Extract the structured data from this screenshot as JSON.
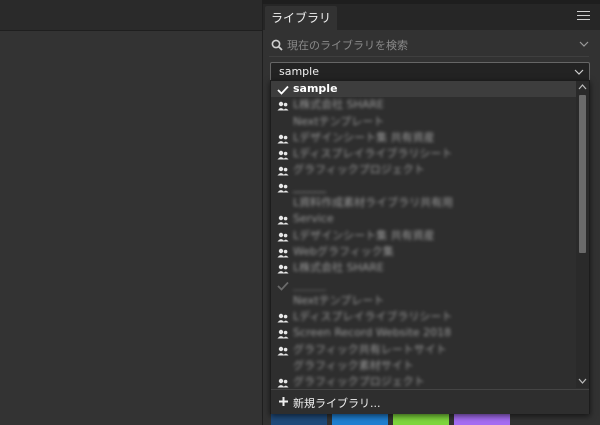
{
  "panel": {
    "tab_label": "ライブラリ",
    "menu_icon": "hamburger-menu-icon"
  },
  "search": {
    "placeholder": "現在のライブラリを検索",
    "icon": "search-icon"
  },
  "library_select": {
    "value": "sample"
  },
  "dropdown": {
    "items": [
      {
        "label": "sample",
        "icon": "checkmark-icon",
        "selected": true,
        "blurred": false
      },
      {
        "label": "L株式会社 SHARE",
        "icon": "shared-users-icon",
        "selected": false,
        "blurred": true
      },
      {
        "label": "Nextテンプレート",
        "icon": "none",
        "selected": false,
        "blurred": true
      },
      {
        "label": "Lデザインシート集 共有資産",
        "icon": "shared-users-icon",
        "selected": false,
        "blurred": true
      },
      {
        "label": "Lディスプレイライブラリシート",
        "icon": "shared-users-icon",
        "selected": false,
        "blurred": true
      },
      {
        "label": "グラフィックプロジェクト",
        "icon": "shared-users-icon",
        "selected": false,
        "blurred": true
      },
      {
        "label": "______",
        "icon": "shared-users-icon",
        "selected": false,
        "blurred": true,
        "separator_after": false
      },
      {
        "label": "L資料作成素材ライブラリ共有用",
        "icon": "none",
        "selected": false,
        "blurred": true
      },
      {
        "label": "Service",
        "icon": "shared-users-icon",
        "selected": false,
        "blurred": true
      },
      {
        "label": "Lデザインシート集 共有資産",
        "icon": "shared-users-icon",
        "selected": false,
        "blurred": true
      },
      {
        "label": "Webグラフィック集",
        "icon": "shared-users-icon",
        "selected": false,
        "blurred": true
      },
      {
        "label": "L株式会社 SHARE",
        "icon": "shared-users-icon",
        "selected": false,
        "blurred": true
      },
      {
        "label": "______",
        "icon": "checkmark-icon-dim",
        "selected": false,
        "blurred": true
      },
      {
        "label": "Nextテンプレート",
        "icon": "none",
        "selected": false,
        "blurred": true
      },
      {
        "label": "Lディスプレイライブラリシート",
        "icon": "shared-users-icon",
        "selected": false,
        "blurred": true
      },
      {
        "label": "Screen Record Website 2018",
        "icon": "shared-users-icon",
        "selected": false,
        "blurred": true
      },
      {
        "label": "グラフィック共有レートサイト",
        "icon": "shared-users-icon",
        "selected": false,
        "blurred": true
      },
      {
        "label": "グラフィック素材サイト",
        "icon": "none",
        "selected": false,
        "blurred": true
      },
      {
        "label": "グラフィックプロジェクト",
        "icon": "shared-users-icon",
        "selected": false,
        "blurred": true
      }
    ],
    "footer_label": "新規ライブラリ..."
  },
  "colors": {
    "bottom_buttons": [
      "#1f4a7a",
      "#1f7fd1",
      "#7ed63d",
      "#a56df2"
    ]
  }
}
